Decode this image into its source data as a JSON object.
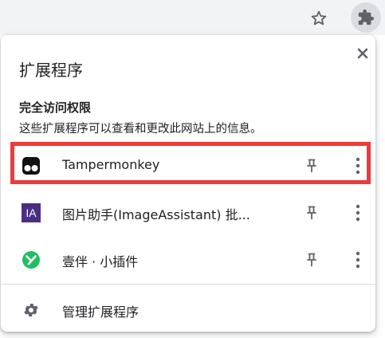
{
  "toolbar": {
    "star_icon": "star-outline-icon",
    "extensions_icon": "puzzle-icon"
  },
  "panel": {
    "title": "扩展程序",
    "close_icon": "close-icon",
    "section_title": "完全访问权限",
    "section_description": "这些扩展程序可以查看和更改此网站上的信息。",
    "extensions": [
      {
        "name": "Tampermonkey",
        "icon": "tampermonkey-icon",
        "highlighted": true
      },
      {
        "name": "图片助手(ImageAssistant) 批...",
        "icon": "image-assistant-icon",
        "icon_text": "IA",
        "highlighted": false
      },
      {
        "name": "壹伴 · 小插件",
        "icon": "yiban-icon",
        "highlighted": false
      }
    ],
    "manage_label": "管理扩展程序"
  },
  "colors": {
    "highlight_border": "#ee3a3a",
    "ia_badge_bg": "#4b2e83",
    "yiban_green": "#1fbf5f",
    "icon_gray": "#5f6368"
  }
}
